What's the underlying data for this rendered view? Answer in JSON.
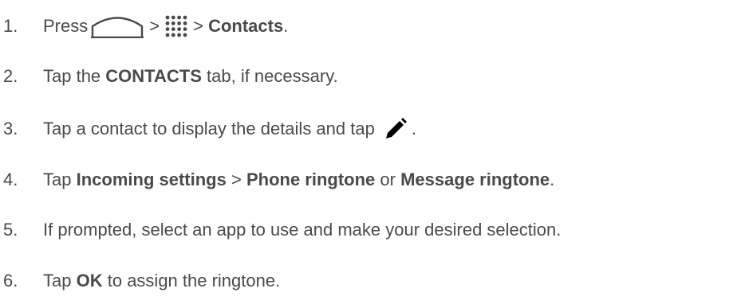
{
  "steps": [
    {
      "number": "1.",
      "pre": "Press",
      "sep1": ">",
      "sep2": ">",
      "bold": "Contacts",
      "end": ".",
      "icons": [
        "home-icon",
        "apps-grid-icon"
      ]
    },
    {
      "number": "2.",
      "pre": "Tap the",
      "bold": "CONTACTS",
      "post": "tab, if necessary."
    },
    {
      "number": "3.",
      "pre": "Tap a contact to display the details and tap",
      "end": ".",
      "icons": [
        "edit-pencil-icon"
      ]
    },
    {
      "number": "4.",
      "pre": "Tap",
      "bold1": "Incoming settings",
      "sep": ">",
      "bold2": "Phone ringtone",
      "or": "or",
      "bold3": "Message ringtone",
      "end": "."
    },
    {
      "number": "5.",
      "text": "If prompted, select an app to use and make your desired selection."
    },
    {
      "number": "6.",
      "pre": "Tap",
      "bold": "OK",
      "post": "to assign the ringtone."
    }
  ]
}
